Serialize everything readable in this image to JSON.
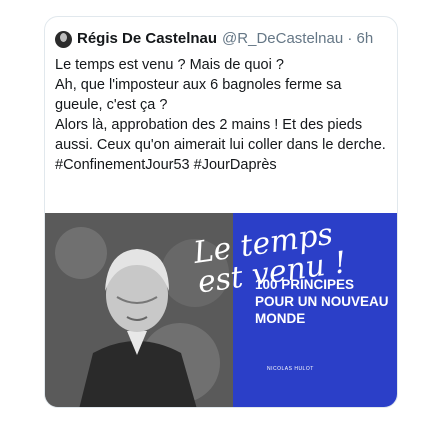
{
  "tweet": {
    "display_name": "Régis De Castelnau",
    "handle": "@R_DeCastelnau",
    "separator": " · ",
    "time": "6h",
    "lines": [
      "Le temps est venu ? Mais de quoi ?",
      "Ah, que l'imposteur aux 6 bagnoles ferme sa gueule, c'est ça ?",
      "Alors là, approbation des 2 mains ! Et des pieds aussi. Ceux qu'on aimerait lui coller dans le derche.",
      "#ConfinementJour53 #JourDaprès"
    ]
  },
  "media": {
    "cover_title": "Le temps\nest venu !",
    "cover_subtitle": "100 PRINCIPES\nPOUR UN NOUVEAU\nMONDE",
    "cover_author": "NICOLAS HULOT",
    "colors": {
      "cover_blue": "#2b3fc8"
    }
  },
  "icons": {
    "avatar": "avatar"
  }
}
